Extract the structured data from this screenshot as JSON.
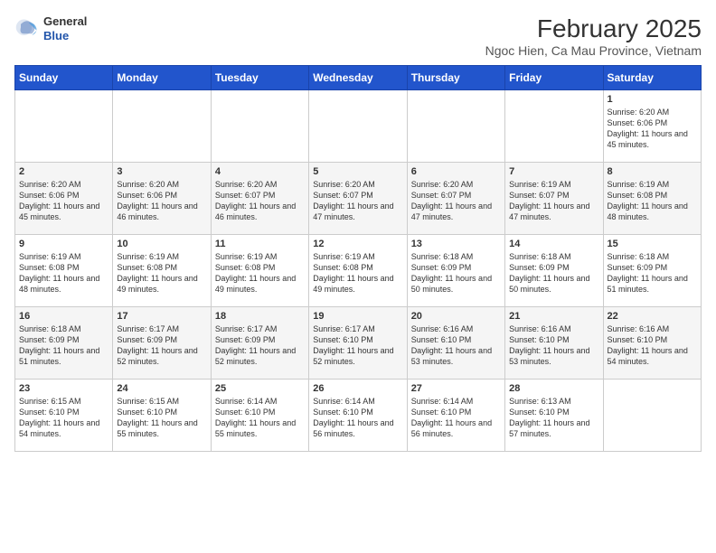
{
  "header": {
    "title": "February 2025",
    "subtitle": "Ngoc Hien, Ca Mau Province, Vietnam",
    "logo_general": "General",
    "logo_blue": "Blue"
  },
  "weekdays": [
    "Sunday",
    "Monday",
    "Tuesday",
    "Wednesday",
    "Thursday",
    "Friday",
    "Saturday"
  ],
  "weeks": [
    [
      {
        "day": "",
        "info": ""
      },
      {
        "day": "",
        "info": ""
      },
      {
        "day": "",
        "info": ""
      },
      {
        "day": "",
        "info": ""
      },
      {
        "day": "",
        "info": ""
      },
      {
        "day": "",
        "info": ""
      },
      {
        "day": "1",
        "info": "Sunrise: 6:20 AM\nSunset: 6:06 PM\nDaylight: 11 hours and 45 minutes."
      }
    ],
    [
      {
        "day": "2",
        "info": "Sunrise: 6:20 AM\nSunset: 6:06 PM\nDaylight: 11 hours and 45 minutes."
      },
      {
        "day": "3",
        "info": "Sunrise: 6:20 AM\nSunset: 6:06 PM\nDaylight: 11 hours and 46 minutes."
      },
      {
        "day": "4",
        "info": "Sunrise: 6:20 AM\nSunset: 6:07 PM\nDaylight: 11 hours and 46 minutes."
      },
      {
        "day": "5",
        "info": "Sunrise: 6:20 AM\nSunset: 6:07 PM\nDaylight: 11 hours and 47 minutes."
      },
      {
        "day": "6",
        "info": "Sunrise: 6:20 AM\nSunset: 6:07 PM\nDaylight: 11 hours and 47 minutes."
      },
      {
        "day": "7",
        "info": "Sunrise: 6:19 AM\nSunset: 6:07 PM\nDaylight: 11 hours and 47 minutes."
      },
      {
        "day": "8",
        "info": "Sunrise: 6:19 AM\nSunset: 6:08 PM\nDaylight: 11 hours and 48 minutes."
      }
    ],
    [
      {
        "day": "9",
        "info": "Sunrise: 6:19 AM\nSunset: 6:08 PM\nDaylight: 11 hours and 48 minutes."
      },
      {
        "day": "10",
        "info": "Sunrise: 6:19 AM\nSunset: 6:08 PM\nDaylight: 11 hours and 49 minutes."
      },
      {
        "day": "11",
        "info": "Sunrise: 6:19 AM\nSunset: 6:08 PM\nDaylight: 11 hours and 49 minutes."
      },
      {
        "day": "12",
        "info": "Sunrise: 6:19 AM\nSunset: 6:08 PM\nDaylight: 11 hours and 49 minutes."
      },
      {
        "day": "13",
        "info": "Sunrise: 6:18 AM\nSunset: 6:09 PM\nDaylight: 11 hours and 50 minutes."
      },
      {
        "day": "14",
        "info": "Sunrise: 6:18 AM\nSunset: 6:09 PM\nDaylight: 11 hours and 50 minutes."
      },
      {
        "day": "15",
        "info": "Sunrise: 6:18 AM\nSunset: 6:09 PM\nDaylight: 11 hours and 51 minutes."
      }
    ],
    [
      {
        "day": "16",
        "info": "Sunrise: 6:18 AM\nSunset: 6:09 PM\nDaylight: 11 hours and 51 minutes."
      },
      {
        "day": "17",
        "info": "Sunrise: 6:17 AM\nSunset: 6:09 PM\nDaylight: 11 hours and 52 minutes."
      },
      {
        "day": "18",
        "info": "Sunrise: 6:17 AM\nSunset: 6:09 PM\nDaylight: 11 hours and 52 minutes."
      },
      {
        "day": "19",
        "info": "Sunrise: 6:17 AM\nSunset: 6:10 PM\nDaylight: 11 hours and 52 minutes."
      },
      {
        "day": "20",
        "info": "Sunrise: 6:16 AM\nSunset: 6:10 PM\nDaylight: 11 hours and 53 minutes."
      },
      {
        "day": "21",
        "info": "Sunrise: 6:16 AM\nSunset: 6:10 PM\nDaylight: 11 hours and 53 minutes."
      },
      {
        "day": "22",
        "info": "Sunrise: 6:16 AM\nSunset: 6:10 PM\nDaylight: 11 hours and 54 minutes."
      }
    ],
    [
      {
        "day": "23",
        "info": "Sunrise: 6:15 AM\nSunset: 6:10 PM\nDaylight: 11 hours and 54 minutes."
      },
      {
        "day": "24",
        "info": "Sunrise: 6:15 AM\nSunset: 6:10 PM\nDaylight: 11 hours and 55 minutes."
      },
      {
        "day": "25",
        "info": "Sunrise: 6:14 AM\nSunset: 6:10 PM\nDaylight: 11 hours and 55 minutes."
      },
      {
        "day": "26",
        "info": "Sunrise: 6:14 AM\nSunset: 6:10 PM\nDaylight: 11 hours and 56 minutes."
      },
      {
        "day": "27",
        "info": "Sunrise: 6:14 AM\nSunset: 6:10 PM\nDaylight: 11 hours and 56 minutes."
      },
      {
        "day": "28",
        "info": "Sunrise: 6:13 AM\nSunset: 6:10 PM\nDaylight: 11 hours and 57 minutes."
      },
      {
        "day": "",
        "info": ""
      }
    ]
  ]
}
